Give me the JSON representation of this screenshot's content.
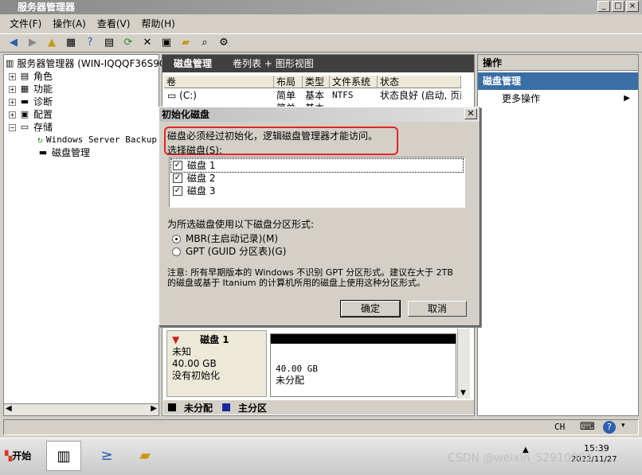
{
  "window": {
    "title": "服务器管理器",
    "buttons": [
      "_",
      "□",
      "×"
    ]
  },
  "menu": [
    "文件(F)",
    "操作(A)",
    "查看(V)",
    "帮助(H)"
  ],
  "tree": {
    "root": "服务器管理器 (WIN-IQQQF36S9G",
    "items": [
      {
        "label": "角色",
        "pm": "+"
      },
      {
        "label": "功能",
        "pm": "+"
      },
      {
        "label": "诊断",
        "pm": "+"
      },
      {
        "label": "配置",
        "pm": "+"
      },
      {
        "label": "存储",
        "pm": "−"
      }
    ],
    "children": [
      "Windows Server Backup",
      "磁盘管理"
    ]
  },
  "center": {
    "header_title": "磁盘管理",
    "header_view": "卷列表 + 图形视图",
    "columns": [
      "卷",
      "布局",
      "类型",
      "文件系统",
      "状态"
    ],
    "row": {
      "volume": "(C:)",
      "layout": "简单",
      "type": "基本",
      "fs": "NTFS",
      "status": "状态良好 (启动, 页面"
    },
    "row2": {
      "layout": "简单",
      "type": "基本"
    }
  },
  "dialog": {
    "title": "初始化磁盘",
    "message": "磁盘必须经过初始化，逻辑磁盘管理器才能访问。",
    "select_label": "选择磁盘(S):",
    "disks": [
      "磁盘 1",
      "磁盘 2",
      "磁盘 3"
    ],
    "partition_label": "为所选磁盘使用以下磁盘分区形式:",
    "options": [
      {
        "label": "MBR(主启动记录)(M)",
        "selected": true
      },
      {
        "label": "GPT (GUID 分区表)(G)",
        "selected": false
      }
    ],
    "note": "注意: 所有早期版本的 Windows 不识别 GPT 分区形式。建议在大于 2TB 的磁盘或基于 Itanium 的计算机所用的磁盘上使用这种分区形式。",
    "ok": "确定",
    "cancel": "取消"
  },
  "disk": {
    "name": "磁盘 1",
    "kind": "未知",
    "size": "40.00 GB",
    "state": "没有初始化",
    "part_size": "40.00 GB",
    "part_state": "未分配"
  },
  "legend": {
    "unallocated": "未分配",
    "primary": "主分区",
    "colors": {
      "unallocated": "#000000",
      "primary": "#1a2a9a"
    }
  },
  "actions": {
    "title": "操作",
    "section": "磁盘管理",
    "more": "更多操作"
  },
  "taskbar": {
    "start": "开始",
    "lang": "CH",
    "time": "15:39",
    "date": "2022/11/27"
  },
  "watermark": "CSDN @weixin_52910057"
}
